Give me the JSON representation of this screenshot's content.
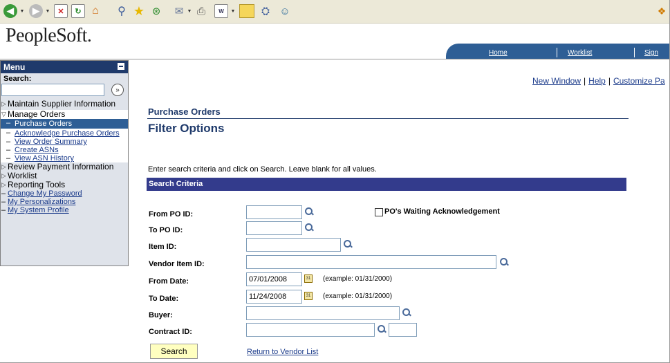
{
  "brand": {
    "logo": "PeopleSoft."
  },
  "nav": {
    "home": "Home",
    "worklist": "Worklist",
    "signout": "Sign"
  },
  "toplinks": {
    "new_window": "New Window",
    "help": "Help",
    "customize": "Customize Pa"
  },
  "menu": {
    "title": "Menu",
    "search_label": "Search:",
    "search_value": "",
    "items": {
      "maintain_supplier": "Maintain Supplier Information",
      "manage_orders": "Manage Orders",
      "purchase_orders": "Purchase Orders",
      "acknowledge_po": "Acknowledge Purchase Orders",
      "view_order_summary": "View Order Summary",
      "create_asns": "Create ASNs",
      "view_asn_history": "View ASN History",
      "review_payment": "Review Payment Information",
      "worklist": "Worklist",
      "reporting_tools": "Reporting Tools",
      "change_password": "Change My Password",
      "my_personalizations": "My Personalizations",
      "my_system_profile": "My System Profile"
    }
  },
  "page": {
    "crumb": "Purchase Orders",
    "title": "Filter Options",
    "instructions": "Enter search criteria and click on Search. Leave blank for all values.",
    "section": "Search Criteria"
  },
  "form": {
    "from_po_label": "From PO ID:",
    "from_po_value": "",
    "to_po_label": "To PO ID:",
    "to_po_value": "",
    "item_label": "Item ID:",
    "item_value": "",
    "vendor_item_label": "Vendor Item ID:",
    "vendor_item_value": "",
    "from_date_label": "From Date:",
    "from_date_value": "07/01/2008",
    "to_date_label": "To Date:",
    "to_date_value": "11/24/2008",
    "date_example": "(example: 01/31/2000)",
    "buyer_label": "Buyer:",
    "buyer_value": "",
    "contract_label": "Contract ID:",
    "contract_value": "",
    "contract_suffix_value": "",
    "waiting_ack_label": "PO's Waiting Acknowledgement",
    "search_button": "Search",
    "return_link": "Return to Vendor List"
  }
}
